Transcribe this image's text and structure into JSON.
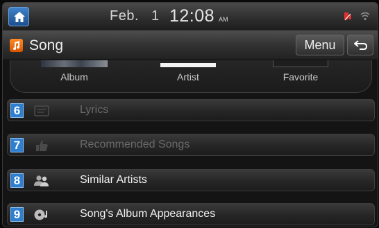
{
  "status_bar": {
    "date": "Feb.",
    "day": "1",
    "time": "12:08",
    "ampm": "AM"
  },
  "header": {
    "title": "Song",
    "menu_label": "Menu"
  },
  "tabs": [
    {
      "label": "Album"
    },
    {
      "label": "Artist"
    },
    {
      "label": "Favorite"
    }
  ],
  "list": [
    {
      "number": "6",
      "label": "Lyrics",
      "icon": "lyrics-icon",
      "enabled": false
    },
    {
      "number": "7",
      "label": "Recommended Songs",
      "icon": "thumbs-up-icon",
      "enabled": false
    },
    {
      "number": "8",
      "label": "Similar Artists",
      "icon": "people-icon",
      "enabled": true
    },
    {
      "number": "9",
      "label": "Song's Album Appearances",
      "icon": "album-disc-icon",
      "enabled": true
    }
  ],
  "colors": {
    "accent_blue": "#2f7fd0",
    "app_orange": "#ff7a1a",
    "status_red": "#e23030"
  }
}
